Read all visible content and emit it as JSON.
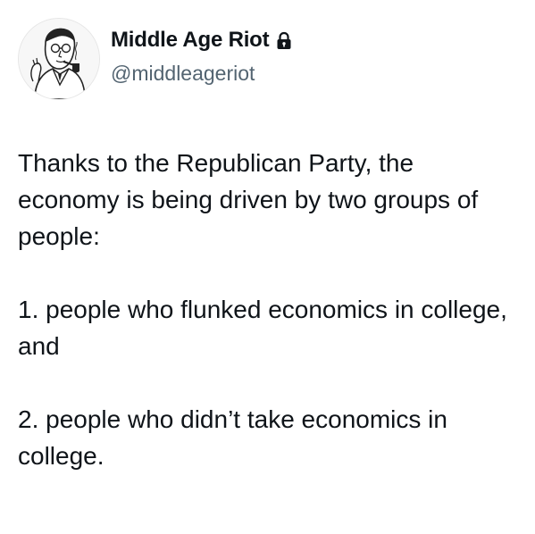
{
  "author": {
    "display_name": "Middle Age Riot",
    "handle": "@middleageriot",
    "avatar_icon": "illustrated-man-with-pipe-avatar",
    "protected_icon": "lock-icon"
  },
  "tweet": {
    "paragraphs": [
      "Thanks to the Republican Party, the economy is being driven by two groups of people:",
      "1. people who flunked economics in college, and",
      "2. people who didn’t take economics in college."
    ]
  },
  "colors": {
    "text_primary": "#0f1419",
    "text_secondary": "#536471",
    "background": "#ffffff"
  }
}
